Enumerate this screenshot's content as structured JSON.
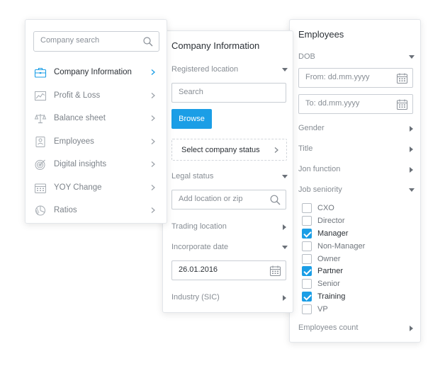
{
  "colors": {
    "accent": "#1b9ee6",
    "text": "#3a3f45",
    "muted": "#878d94",
    "border": "#c9ced4"
  },
  "nav": {
    "search": {
      "placeholder": "Company search",
      "value": ""
    },
    "items": [
      {
        "label": "Company Information",
        "icon": "briefcase-icon",
        "active": true
      },
      {
        "label": "Profit & Loss",
        "icon": "line-chart-icon",
        "active": false
      },
      {
        "label": "Balance sheet",
        "icon": "scales-icon",
        "active": false
      },
      {
        "label": "Employees",
        "icon": "id-card-icon",
        "active": false
      },
      {
        "label": "Digital insights",
        "icon": "target-icon",
        "active": false
      },
      {
        "label": "YOY Change",
        "icon": "calendar-icon",
        "active": false
      },
      {
        "label": "Ratios",
        "icon": "pie-chart-icon",
        "active": false
      }
    ]
  },
  "company": {
    "title": "Company Information",
    "registered_location": {
      "label": "Registered location",
      "search_placeholder": "Search",
      "browse_label": "Browse",
      "status_select_label": "Select company status"
    },
    "legal_status": {
      "label": "Legal status",
      "location_placeholder": "Add location or zip"
    },
    "trading_location": {
      "label": "Trading location"
    },
    "incorporate_date": {
      "label": "Incorporate date",
      "value": "26.01.2016"
    },
    "industry": {
      "label": "Industry (SIC)"
    }
  },
  "employees": {
    "title": "Employees",
    "dob": {
      "label": "DOB",
      "from_placeholder": "From: dd.mm.yyyy",
      "to_placeholder": "To: dd.mm.yyyy"
    },
    "gender": "Gender",
    "title_filter": "Title",
    "job_function": "Jon function",
    "job_seniority": {
      "label": "Job seniority",
      "options": [
        {
          "label": "CXO",
          "checked": false
        },
        {
          "label": "Director",
          "checked": false
        },
        {
          "label": "Manager",
          "checked": true
        },
        {
          "label": "Non-Manager",
          "checked": false
        },
        {
          "label": "Owner",
          "checked": false
        },
        {
          "label": "Partner",
          "checked": true
        },
        {
          "label": "Senior",
          "checked": false
        },
        {
          "label": "Training",
          "checked": true
        },
        {
          "label": "VP",
          "checked": false
        }
      ]
    },
    "employees_count": "Employees count"
  }
}
